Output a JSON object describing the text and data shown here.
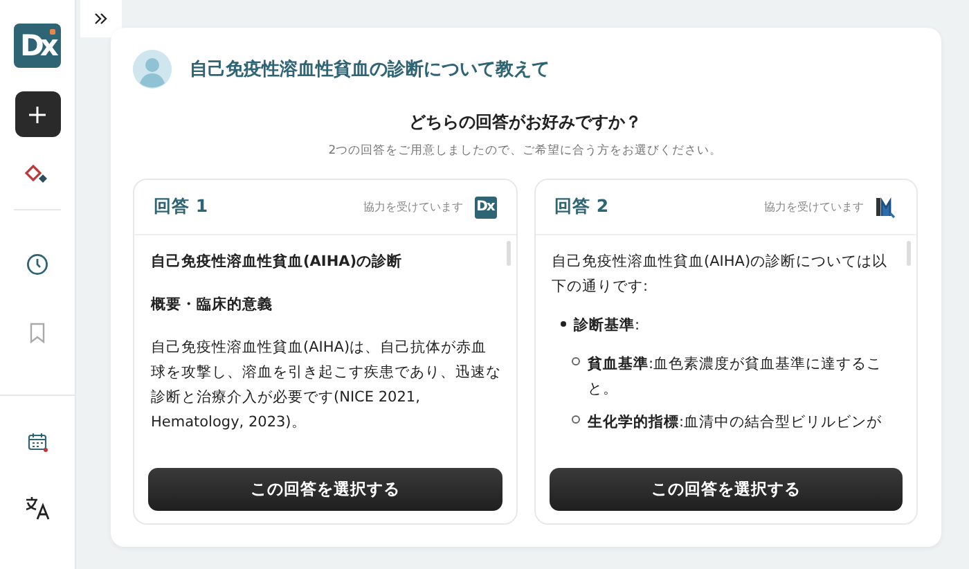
{
  "sidebar": {
    "logo_text": "Dx"
  },
  "question": {
    "text": "自己免疫性溶血性貧血の診断について教えて"
  },
  "prompt": {
    "title": "どちらの回答がお好みですか？",
    "subtitle": "2つの回答をご用意しましたので、ご希望に合う方をお選びください。"
  },
  "answers": [
    {
      "label": "回答 1",
      "credit": "協力を受けています",
      "provider_text": "Dx",
      "button": "この回答を選択する",
      "blocks": [
        {
          "kind": "heading",
          "text": "自己免疫性溶血性貧血(AIHA)の診断"
        },
        {
          "kind": "heading",
          "text": "概要・臨床的意義"
        },
        {
          "kind": "paragraph",
          "text": "自己免疫性溶血性貧血(AIHA)は、自己抗体が赤血球を攻撃し、溶血を引き起こす疾患であり、迅速な診断と治療介入が必要です(NICE 2021, Hematology, 2023)。"
        }
      ]
    },
    {
      "label": "回答 2",
      "credit": "協力を受けています",
      "button": "この回答を選択する",
      "blocks": [
        {
          "kind": "paragraph",
          "text": "自己免疫性溶血性貧血(AIHA)の診断については以下の通りです:"
        },
        {
          "kind": "bullet",
          "text": "**診断基準**:",
          "children": [
            {
              "text": "**貧血基準**:血色素濃度が貧血基準に達すること。"
            },
            {
              "text": "**生化学的指標**:血清中の結合型ビリルビンが"
            }
          ]
        }
      ]
    }
  ]
}
